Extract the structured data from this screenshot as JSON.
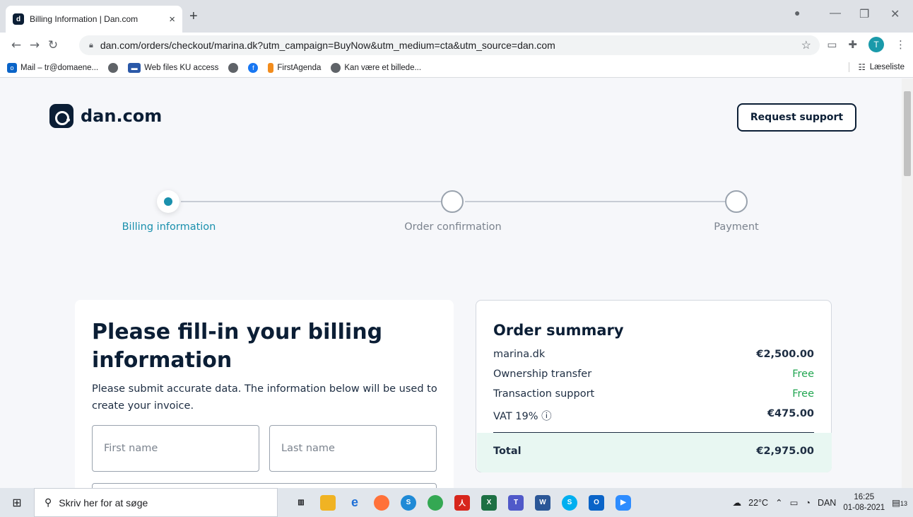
{
  "browser": {
    "tab_title": "Billing Information | Dan.com",
    "tab_close": "×",
    "new_tab": "+",
    "url": "dan.com/orders/checkout/marina.dk?utm_campaign=BuyNow&utm_medium=cta&utm_source=dan.com",
    "profile_initial": "T",
    "bookmarks": [
      {
        "label": "Mail – tr@domaene..."
      },
      {
        "label": ""
      },
      {
        "label": "Web files KU access"
      },
      {
        "label": ""
      },
      {
        "label": ""
      },
      {
        "label": "FirstAgenda"
      },
      {
        "label": "Kan være et billede..."
      }
    ],
    "reading_list": "Læseliste"
  },
  "header": {
    "logo_text": "dan.com",
    "support_button": "Request support"
  },
  "steps": [
    {
      "label": "Billing information",
      "state": "active"
    },
    {
      "label": "Order confirmation",
      "state": "pending"
    },
    {
      "label": "Payment",
      "state": "pending"
    }
  ],
  "billing": {
    "title": "Please fill-in your billing information",
    "description": "Please submit accurate data. The information below will be used to create your invoice.",
    "first_name_placeholder": "First name",
    "last_name_placeholder": "Last name"
  },
  "summary": {
    "title": "Order summary",
    "rows": [
      {
        "label": "marina.dk",
        "value": "€2,500.00"
      },
      {
        "label": "Ownership transfer",
        "value": "Free"
      },
      {
        "label": "Transaction support",
        "value": "Free"
      },
      {
        "label": "VAT 19%",
        "value": "€475.00"
      }
    ],
    "vat_info_icon": "ⓘ",
    "total_label": "Total",
    "total_value": "€2,975.00"
  },
  "taskbar": {
    "search_placeholder": "Skriv her for at søge",
    "weather": "22°C",
    "language": "DAN",
    "time": "16:25",
    "date": "01-08-2021",
    "notifications": "13"
  },
  "colors": {
    "brand": "#0b1e35",
    "accent": "#1a90ad",
    "free": "#22a651",
    "total_bg": "#e8f7f2"
  }
}
